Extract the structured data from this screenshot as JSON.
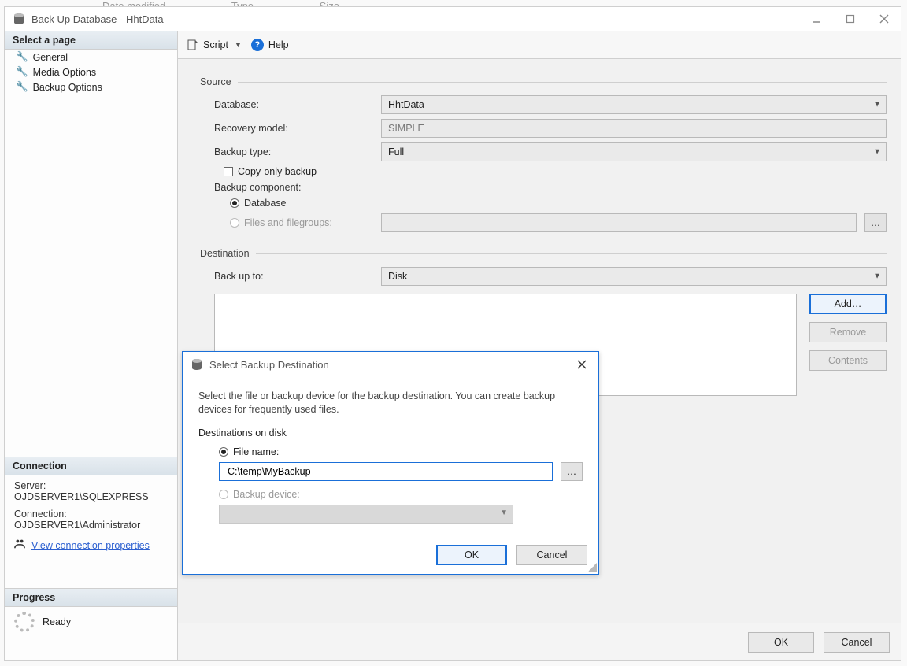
{
  "bg_columns": [
    "Date modified",
    "Type",
    "Size"
  ],
  "window_title": "Back Up Database - HhtData",
  "sidebar": {
    "select_page": "Select a page",
    "pages": [
      "General",
      "Media Options",
      "Backup Options"
    ],
    "connection_title": "Connection",
    "server_label": "Server:",
    "server_value": "OJDSERVER1\\SQLEXPRESS",
    "connection_label": "Connection:",
    "connection_value": "OJDSERVER1\\Administrator",
    "view_conn_props": "View connection properties",
    "progress_title": "Progress",
    "progress_status": "Ready"
  },
  "toolbar": {
    "script": "Script",
    "help": "Help"
  },
  "source": {
    "group": "Source",
    "database_label": "Database:",
    "database_value": "HhtData",
    "recovery_label": "Recovery model:",
    "recovery_value": "SIMPLE",
    "backup_type_label": "Backup type:",
    "backup_type_value": "Full",
    "copy_only": "Copy-only backup",
    "component_label": "Backup component:",
    "component_db": "Database",
    "component_files": "Files and filegroups:"
  },
  "destination": {
    "group": "Destination",
    "backup_to_label": "Back up to:",
    "backup_to_value": "Disk",
    "buttons": {
      "add": "Add…",
      "remove": "Remove",
      "contents": "Contents"
    }
  },
  "bottom": {
    "ok": "OK",
    "cancel": "Cancel"
  },
  "subdialog": {
    "title": "Select Backup Destination",
    "desc": "Select the file or backup device for the backup destination. You can create backup devices for frequently used files.",
    "group": "Destinations on disk",
    "file_name_label": "File name:",
    "file_name_value": "C:\\temp\\MyBackup",
    "browse": "…",
    "backup_device_label": "Backup device:",
    "ok": "OK",
    "cancel": "Cancel"
  }
}
